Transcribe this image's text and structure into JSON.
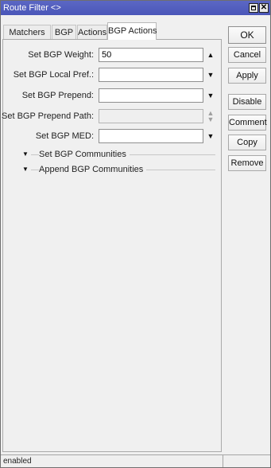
{
  "window": {
    "title": "Route Filter <>"
  },
  "tabs": [
    {
      "label": "Matchers"
    },
    {
      "label": "BGP"
    },
    {
      "label": "Actions"
    },
    {
      "label": "BGP Actions"
    }
  ],
  "fields": {
    "bgp_weight": {
      "label": "Set BGP Weight:",
      "value": "50"
    },
    "bgp_local_pref": {
      "label": "Set BGP Local Pref.:",
      "value": ""
    },
    "bgp_prepend": {
      "label": "Set BGP Prepend:",
      "value": ""
    },
    "bgp_prepend_path": {
      "label": "Set BGP Prepend Path:",
      "value": ""
    },
    "bgp_med": {
      "label": "Set BGP MED:",
      "value": ""
    }
  },
  "sections": {
    "set_communities": {
      "label": "Set BGP Communities"
    },
    "append_communities": {
      "label": "Append BGP Communities"
    }
  },
  "buttons": {
    "ok": "OK",
    "cancel": "Cancel",
    "apply": "Apply",
    "disable": "Disable",
    "comment": "Comment",
    "copy": "Copy",
    "remove": "Remove"
  },
  "status": {
    "text": "enabled"
  }
}
